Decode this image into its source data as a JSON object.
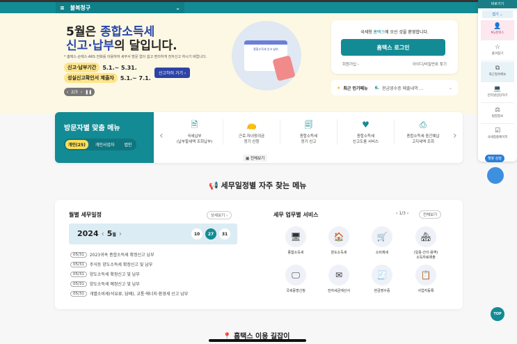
{
  "topbar": {
    "region": "불복청구"
  },
  "hero": {
    "title_part1": "5월은 ",
    "title_highlight1": "종합소득세",
    "title_highlight2": "신고·납부",
    "title_part2": "의 달입니다.",
    "subtitle": "* 홈택스·손택스·ARS 전화를 이용하여 세무서 방문 없이 쉽고 편리하게 전자신고 하시기 바랍니다.",
    "period1_label": "신고·납부기간",
    "period1": "5.1.~ 5.31.",
    "period2_label": "성실신고확인서 제출자",
    "period2": "5.1.~ 7.1.",
    "go_button": "신고하러 가기 ›",
    "pager": "2/3",
    "illustration_label": "종합소득세 신고 납부"
  },
  "login": {
    "welcome_pre": "국세청 ",
    "welcome_brand": "홈택스",
    "welcome_post": "에 오신 것을 환영합니다.",
    "button": "홈택스 로그인",
    "signup": "회원가입 ›",
    "find": "아이디/비밀번호 찾기"
  },
  "popular": {
    "label": "최근 인기메뉴",
    "rank": "6.",
    "item": "현금영수증 매출내역 ..."
  },
  "visitor": {
    "title": "방문자별 맞춤 메뉴",
    "tabs": [
      "개인(25)",
      "개인사업자",
      "법인"
    ],
    "items": [
      {
        "l1": "국세납부",
        "l2": "(납부할세액 조회납부)"
      },
      {
        "l1": "근로·자녀장려금",
        "l2": "정기 신청"
      },
      {
        "l1": "종합소득세",
        "l2": "정기 신고"
      },
      {
        "l1": "종합소득세",
        "l2": "신고도움 서비스"
      },
      {
        "l1": "종합소득세 중간예납",
        "l2": "고지세액 조회"
      }
    ],
    "all": "전체보기"
  },
  "section_title": "세무일정별 자주 찾는 메뉴",
  "schedule": {
    "title": "월별 세무일정",
    "detail": "상세보기 ›",
    "year": "2024",
    "month": "5",
    "month_unit": "월",
    "days": [
      "10",
      "27",
      "31"
    ],
    "selected_day": "27",
    "items": [
      {
        "date": "05/31",
        "text": "2023귀속 종합소득세 확정신고 납부"
      },
      {
        "date": "05/31",
        "text": "주식등 양도소득세 확정신고 및 납부"
      },
      {
        "date": "05/31",
        "text": "양도소득세 확정신고 및 납부"
      },
      {
        "date": "05/31",
        "text": "양도소득세 예정신고 및 납부"
      },
      {
        "date": "05/31",
        "text": "개별소비세(석유류, 담배), 교통·에너지·환경세 신고 납부"
      }
    ]
  },
  "services": {
    "title": "세무 업무별 서비스",
    "pager": "1/3",
    "all": "전체보기",
    "items": [
      {
        "l1": "종합소득세",
        "l2": ""
      },
      {
        "l1": "양도소득세",
        "l2": ""
      },
      {
        "l1": "소비제세",
        "l2": ""
      },
      {
        "l1": "(일용·간이·용역)",
        "l2": "소득자료제출"
      },
      {
        "l1": "국세증명신청",
        "l2": ""
      },
      {
        "l1": "전자세금계산서",
        "l2": ""
      },
      {
        "l1": "현금영수증",
        "l2": ""
      },
      {
        "l1": "사업자등록",
        "l2": ""
      }
    ]
  },
  "sidebar": {
    "header": "바로가기",
    "fold": "접기 ⌄",
    "items": [
      "My홈택스",
      "즐겨찾기",
      "최근접속메뉴",
      "인터넷상담하기",
      "법령정보",
      "국세청홈페이지"
    ]
  },
  "chatbot": "챗봇 상담",
  "top_button": "TOP",
  "guide": "홈택스 이용 길잡이",
  "colors": {
    "brand": "#138b94",
    "accent_blue": "#2d43a5",
    "highlight": "#fde058"
  }
}
